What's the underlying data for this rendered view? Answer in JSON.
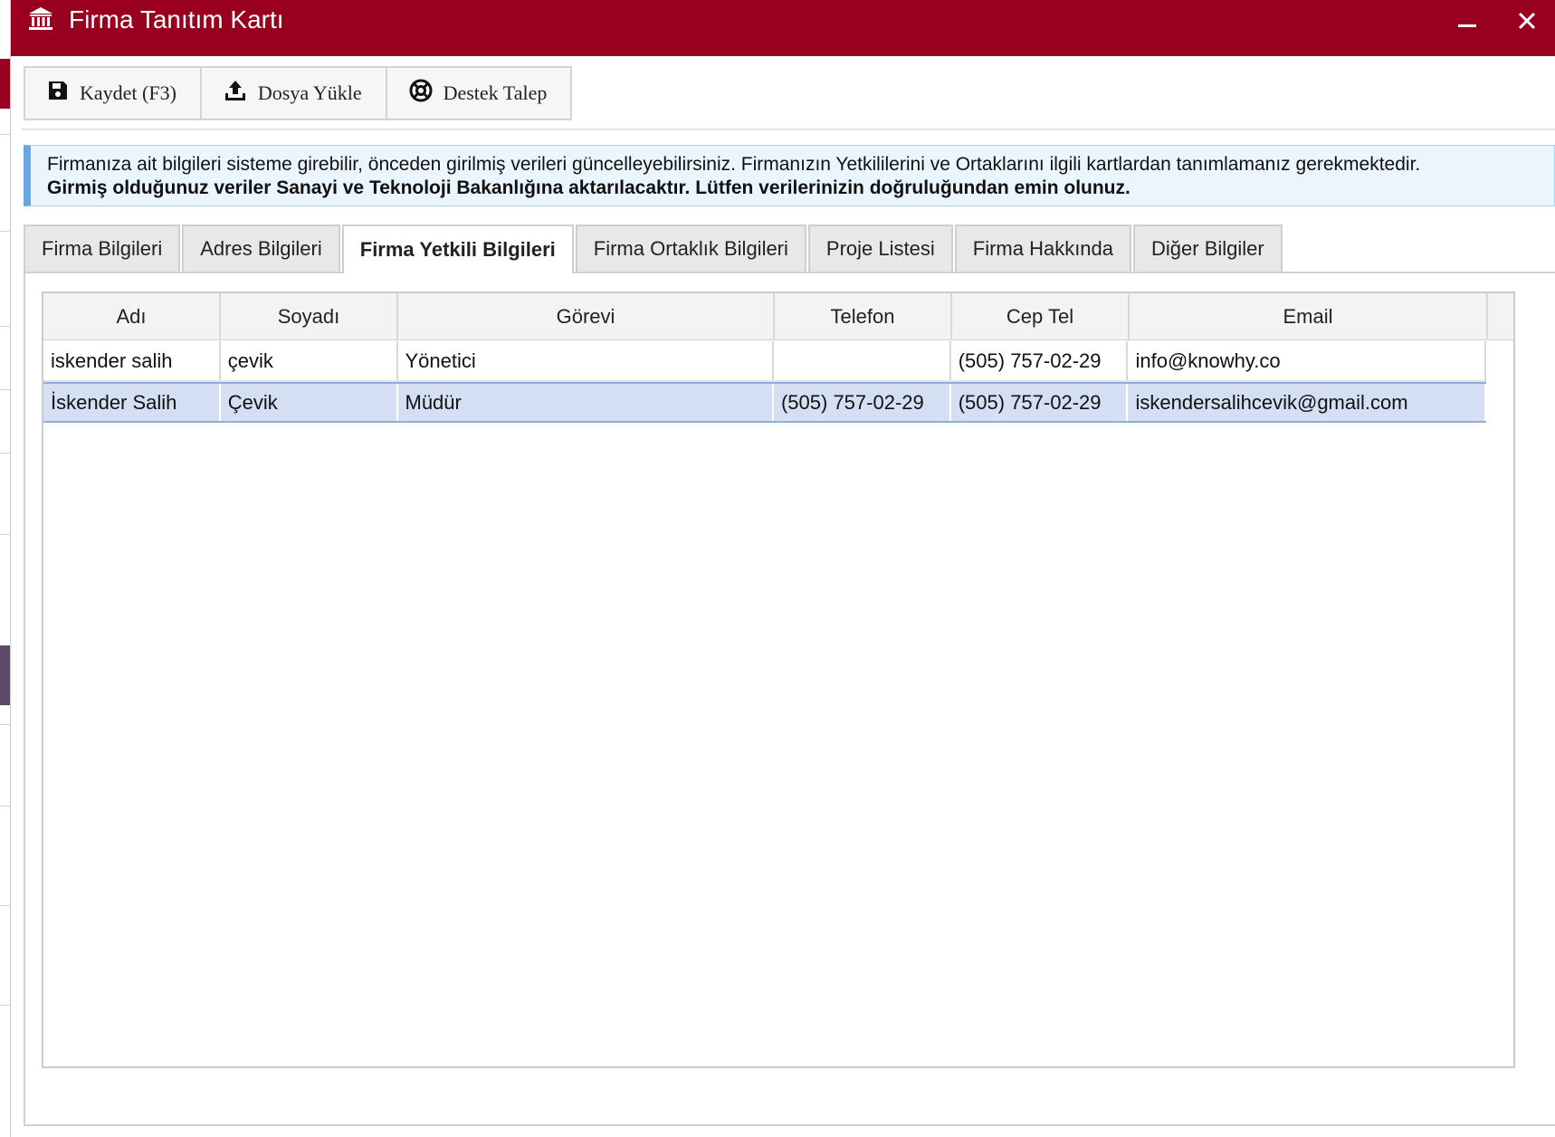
{
  "window": {
    "title": "Firma Tanıtım Kartı",
    "icon": "institution-icon",
    "controls": {
      "minimize": "minimize-icon",
      "close": "close-icon"
    }
  },
  "toolbar": {
    "save_label": "Kaydet (F3)",
    "upload_label": "Dosya Yükle",
    "support_label": "Destek Talep"
  },
  "info": {
    "line1": "Firmanıza ait bilgileri sisteme girebilir, önceden girilmiş verileri güncelleyebilirsiniz. Firmanızın Yetkililerini ve Ortaklarını ilgili kartlardan tanımlamanız gerekmektedir.",
    "line2": "Girmiş olduğunuz veriler Sanayi ve Teknoloji Bakanlığına aktarılacaktır. Lütfen verilerinizin doğruluğundan emin olunuz."
  },
  "tabs": [
    {
      "label": "Firma Bilgileri"
    },
    {
      "label": "Adres Bilgileri"
    },
    {
      "label": "Firma Yetkili Bilgileri",
      "active": true
    },
    {
      "label": "Firma Ortaklık Bilgileri"
    },
    {
      "label": "Proje Listesi"
    },
    {
      "label": "Firma Hakkında"
    },
    {
      "label": "Diğer Bilgiler"
    }
  ],
  "grid": {
    "columns": [
      "Adı",
      "Soyadı",
      "Görevi",
      "Telefon",
      "Cep Tel",
      "Email"
    ],
    "rows": [
      [
        "iskender salih",
        "çevik",
        "Yönetici",
        "",
        "(505) 757-02-29",
        "info@knowhy.co"
      ],
      [
        "İskender Salih",
        "Çevik",
        "Müdür",
        "(505) 757-02-29",
        "(505) 757-02-29",
        "iskendersalihcevik@gmail.com"
      ]
    ],
    "selected_row": 1
  },
  "colors": {
    "titlebar": "#990020",
    "info_border": "#6aa6e2",
    "selected_row": "#d4dff4"
  }
}
